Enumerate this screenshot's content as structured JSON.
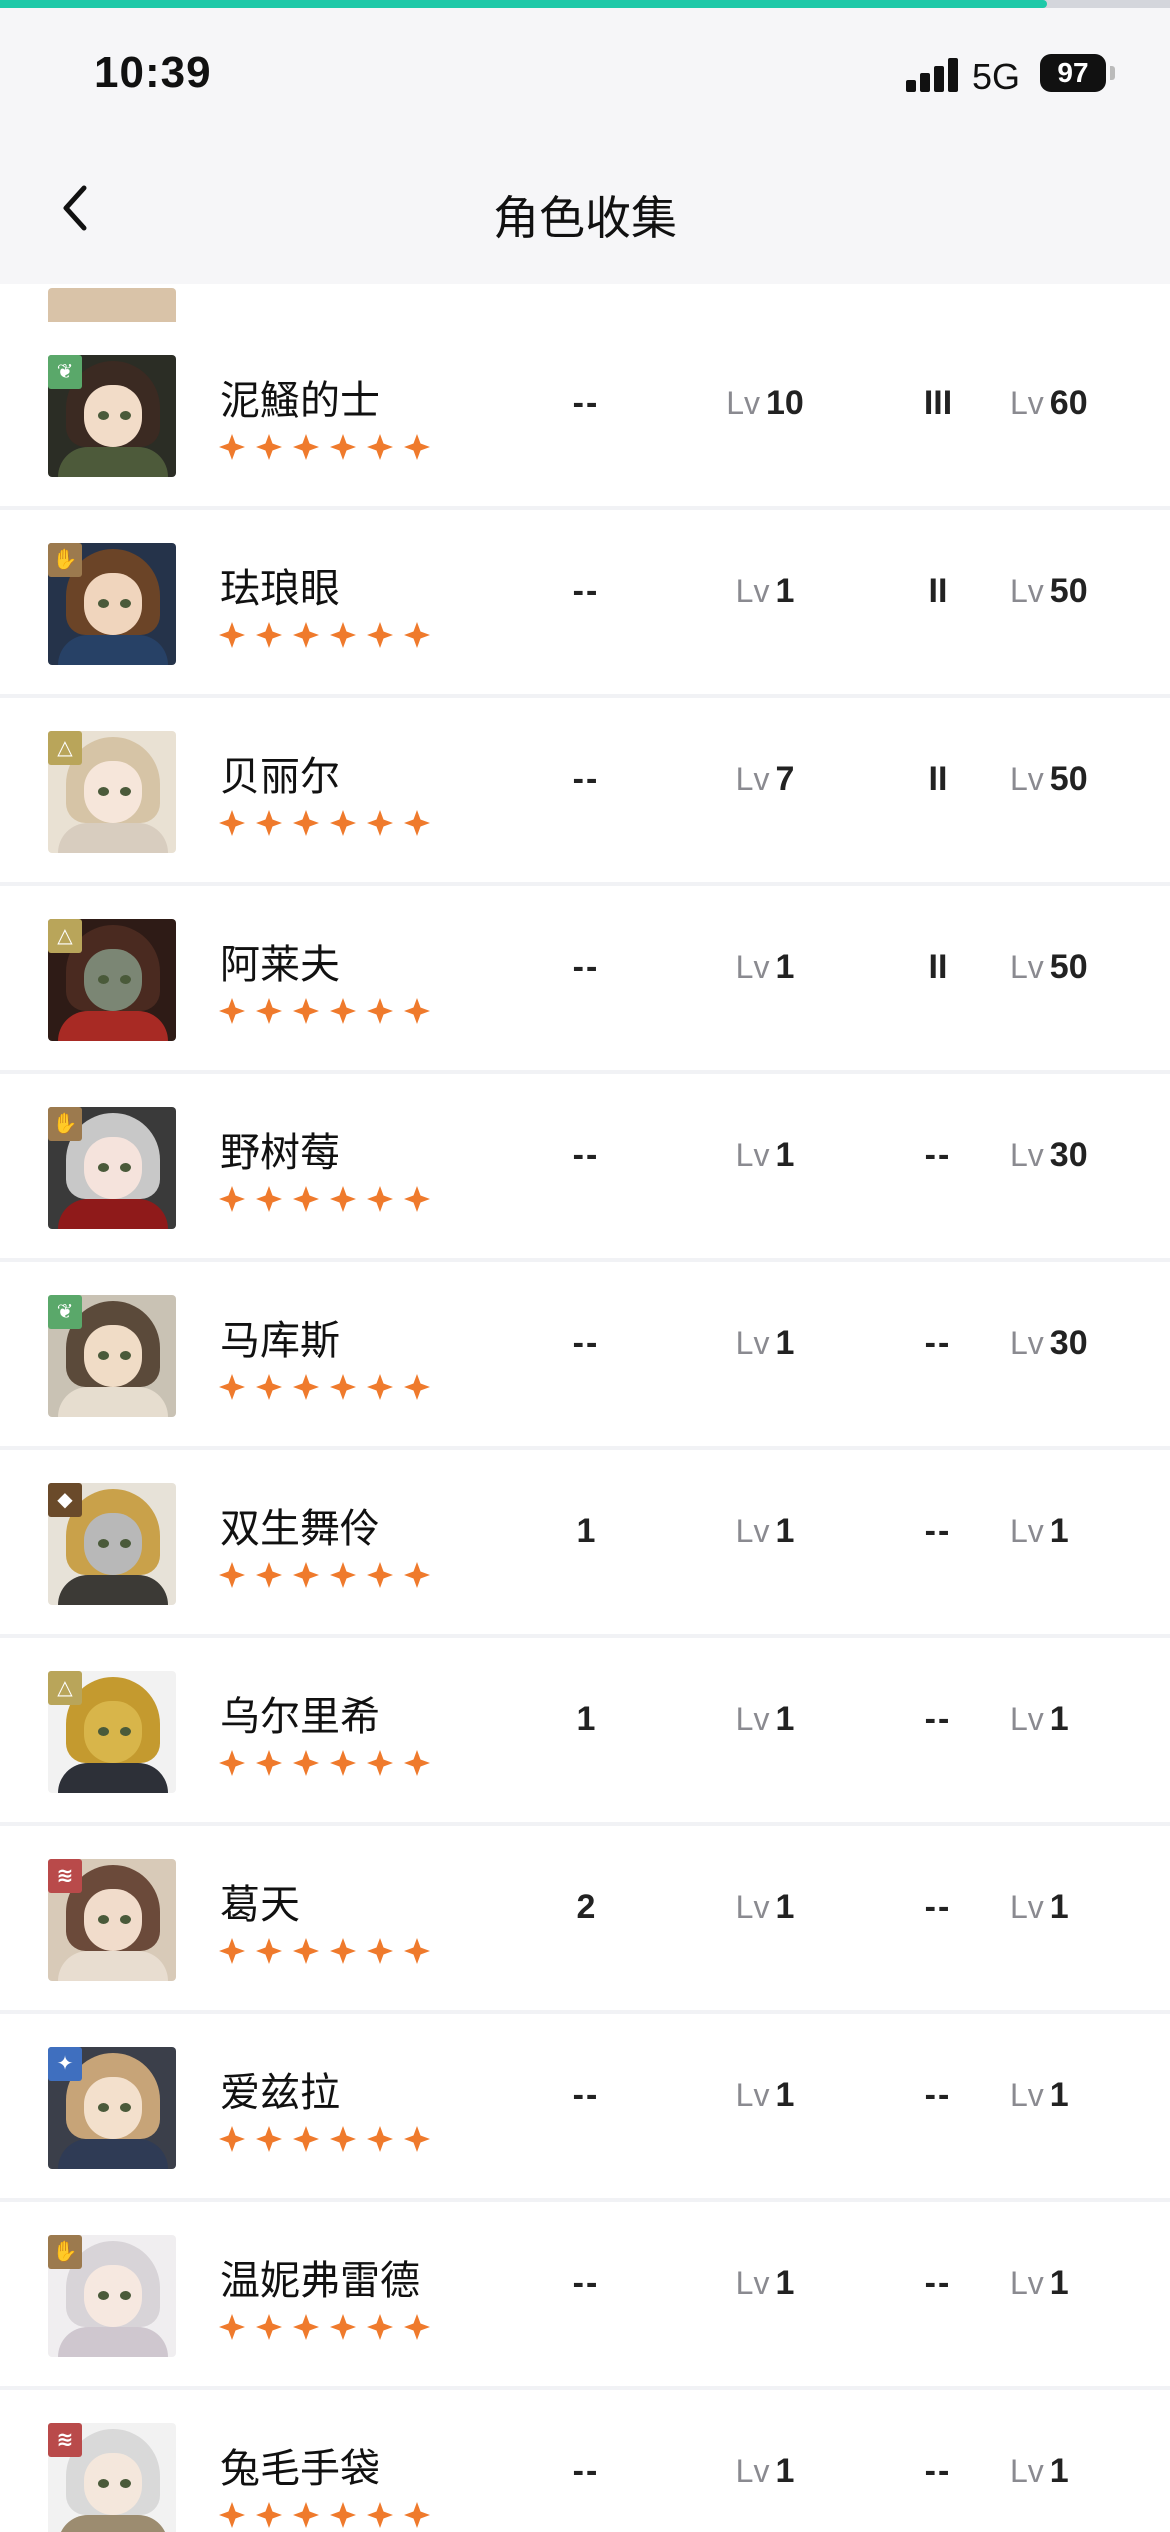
{
  "status_bar": {
    "time": "10:39",
    "network": "5G",
    "battery": "97"
  },
  "progress": {
    "fraction": 0.895,
    "color": "#1ec9a8"
  },
  "nav": {
    "title": "角色收集",
    "back_icon": "chevron-left-icon"
  },
  "characters": [
    {
      "name": "泥鰠的士",
      "element": "leaf",
      "element_color": "#5aa86a",
      "col1": "--",
      "level": "10",
      "col3": "III",
      "cap": "60",
      "palette": [
        "#2b2d25",
        "#3b2a22",
        "#f2dcc8",
        "#4d5a3a"
      ]
    },
    {
      "name": "珐琅眼",
      "element": "hand",
      "element_color": "#9c7a4e",
      "col1": "--",
      "level": "1",
      "col3": "II",
      "cap": "50",
      "palette": [
        "#25334a",
        "#6b4427",
        "#f0d5bd",
        "#274166"
      ]
    },
    {
      "name": "贝丽尔",
      "element": "triangle",
      "element_color": "#b9a55a",
      "col1": "--",
      "level": "7",
      "col3": "II",
      "cap": "50",
      "palette": [
        "#e9e1d3",
        "#d6c4a6",
        "#f6e6da",
        "#d8cdbf"
      ]
    },
    {
      "name": "阿莱夫",
      "element": "triangle",
      "element_color": "#b9a55a",
      "col1": "--",
      "level": "1",
      "col3": "II",
      "cap": "50",
      "palette": [
        "#2e1b16",
        "#4a2a20",
        "#7b8674",
        "#a82a24"
      ]
    },
    {
      "name": "野树莓",
      "element": "hand",
      "element_color": "#9c7a4e",
      "col1": "--",
      "level": "1",
      "col3": "--",
      "cap": "30",
      "palette": [
        "#3a3a3a",
        "#c8c8c8",
        "#f5e3dc",
        "#8f1a1a"
      ]
    },
    {
      "name": "马库斯",
      "element": "leaf",
      "element_color": "#5aa86a",
      "col1": "--",
      "level": "1",
      "col3": "--",
      "cap": "30",
      "palette": [
        "#c9c2b4",
        "#5b4a3a",
        "#f0dcc6",
        "#e6ddcf"
      ]
    },
    {
      "name": "双生舞伶",
      "element": "diamond",
      "element_color": "#6a4a2a",
      "col1": "1",
      "level": "1",
      "col3": "--",
      "cap": "1",
      "palette": [
        "#e7e2d8",
        "#c9a14a",
        "#b8b8b8",
        "#3c3a36"
      ]
    },
    {
      "name": "乌尔里希",
      "element": "triangle",
      "element_color": "#b9a55a",
      "col1": "1",
      "level": "1",
      "col3": "--",
      "cap": "1",
      "palette": [
        "#f2f2f2",
        "#c49a2f",
        "#d8b54a",
        "#2d3038"
      ]
    },
    {
      "name": "葛天",
      "element": "feather",
      "element_color": "#b94a4a",
      "col1": "2",
      "level": "1",
      "col3": "--",
      "cap": "1",
      "palette": [
        "#d8cab8",
        "#6b4a3a",
        "#f1dccb",
        "#e8ddd0"
      ]
    },
    {
      "name": "爱兹拉",
      "element": "star",
      "element_color": "#3f6fbf",
      "col1": "--",
      "level": "1",
      "col3": "--",
      "cap": "1",
      "palette": [
        "#3b3f4a",
        "#c7a478",
        "#f3e0cc",
        "#2f3b55"
      ]
    },
    {
      "name": "温妮弗雷德",
      "element": "hand",
      "element_color": "#9c7a4e",
      "col1": "--",
      "level": "1",
      "col3": "--",
      "cap": "1",
      "palette": [
        "#f0eef0",
        "#d8d4d8",
        "#f6e8e0",
        "#cfc7cf"
      ]
    },
    {
      "name": "兔毛手袋",
      "element": "feather",
      "element_color": "#b94a4a",
      "col1": "--",
      "level": "1",
      "col3": "--",
      "cap": "1",
      "palette": [
        "#f2f2f2",
        "#d9d9d9",
        "#f4e7dc",
        "#9c8c70"
      ]
    }
  ],
  "labels": {
    "lv": "Lv"
  },
  "star_count": 6,
  "star_color": "#ef7a2c"
}
